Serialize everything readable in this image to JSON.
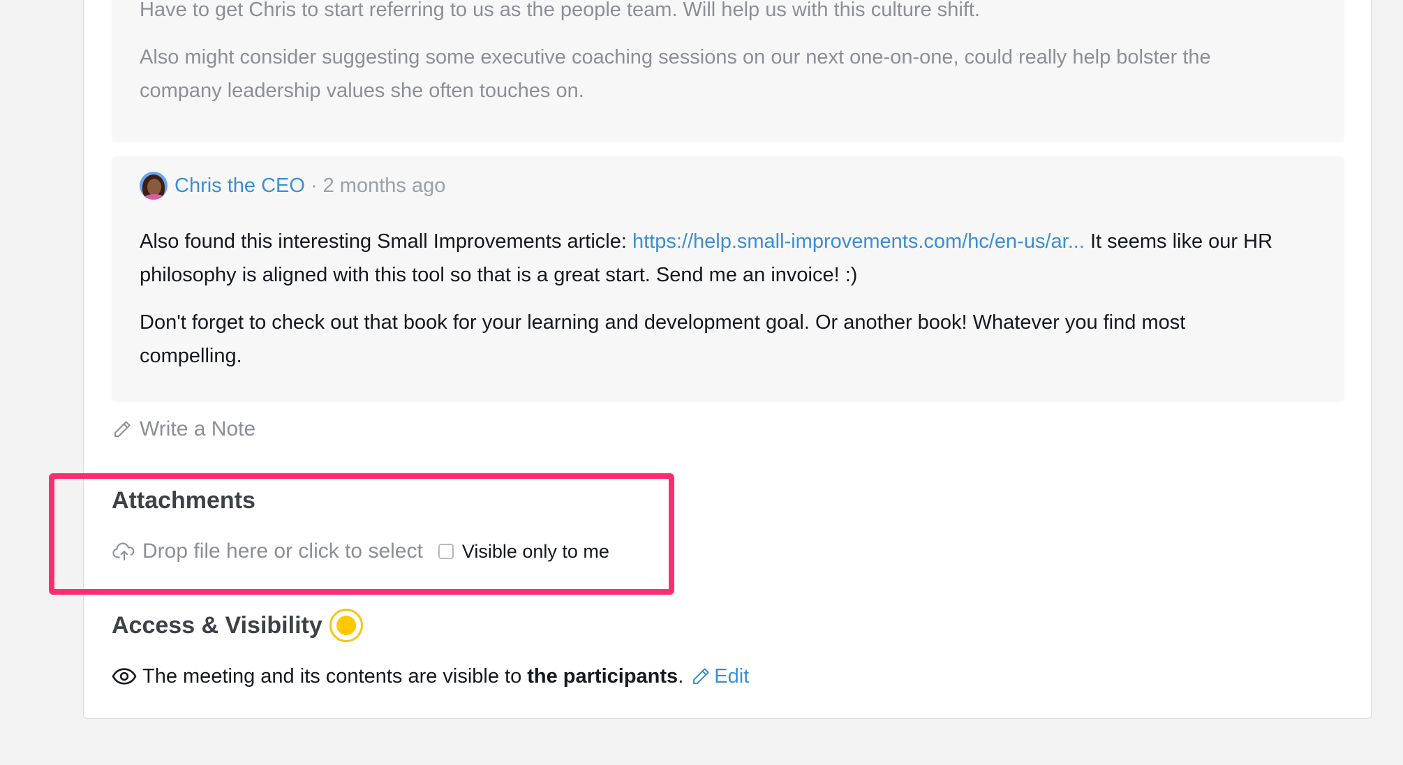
{
  "notes": [
    {
      "paragraphs": [
        "Have to get Chris to start referring to us as the people team. Will help us with this culture shift.",
        "Also might consider suggesting some executive coaching sessions on our next one-on-one, could really help bolster the company leadership values she often touches on."
      ]
    },
    {
      "author": "Chris the CEO",
      "separator": "·",
      "time": "2 months ago",
      "p1_before": "Also found this interesting Small Improvements article: ",
      "p1_link": "https://help.small-improvements.com/hc/en-us/ar...",
      "p1_after": " It seems like our HR philosophy is aligned with this tool so that is a great start. Send me an invoice! :)",
      "p2": "Don't forget to check out that book for your learning and development goal. Or another book! Whatever you find most compelling."
    }
  ],
  "write_note": {
    "label": "Write a Note",
    "icon": "pencil-icon"
  },
  "attachments": {
    "title": "Attachments",
    "drop_text": "Drop file here or click to select",
    "visible_only_label": "Visible only to me",
    "visible_only_checked": false,
    "icon": "cloud-upload-icon"
  },
  "access": {
    "title": "Access & Visibility",
    "status_color": "#ffc800",
    "text_before": "The meeting and its contents are visible to",
    "strong": "the participants",
    "period": ".",
    "edit_label": "Edit",
    "icon": "eye-icon"
  },
  "colors": {
    "link": "#3a8fd6",
    "highlight": "#ff2d6f",
    "note_background": "#f7f7f8"
  }
}
